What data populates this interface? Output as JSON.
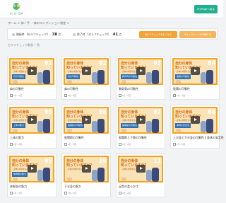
{
  "header": {
    "logo_text": "ぱくぱく広場",
    "mypage_label": "MyPageへ戻る"
  },
  "breadcrumb": "ホーム > 体 / 手 ・体のコンディション測定 >",
  "stats": {
    "before_label": "開始時 【セルフチェック】",
    "before_value": "38",
    "before_unit": "点",
    "after_label": "終了時 【セルフチェック】",
    "after_value": "41",
    "after_unit": "点",
    "btn_primary": "セルフチェックをおこなう",
    "btn_secondary": "チェックシートを印刷する"
  },
  "section_title": "セルフチェック動画 一覧",
  "cards": [
    {
      "num": "01",
      "title": "肩の可動性",
      "date": "1分 / 2回",
      "label": "肩の可動性"
    },
    {
      "num": "02",
      "title": "肩の可動性",
      "date": "1分 / 2回",
      "label": "肩の可動性"
    },
    {
      "num": "03",
      "title": "胸背骨の可動性",
      "date": "1分 / 2回",
      "label": "胸背骨の可動性"
    },
    {
      "num": "04",
      "title": "股関の可動性",
      "date": "1分 / 2回",
      "label": "股関の可動性"
    },
    {
      "num": "05",
      "title": "上体の筋力",
      "date": "1分 / 2回",
      "label": "上体の筋力"
    },
    {
      "num": "06",
      "title": "股関節の可動性",
      "date": "1分 / 2回",
      "label": "股関節の可動性"
    },
    {
      "num": "07",
      "title": "股関節と下肢の可動性",
      "date": "1分 / 2回",
      "label": "股関節の可動性"
    },
    {
      "num": "08",
      "title": "上半身と下半身の可動性と身体の安定性",
      "date": "1分 / 2回",
      "label": "体幹の安定性"
    },
    {
      "num": "09",
      "title": "体幹部の筋力",
      "date": "1分 / 2回",
      "label": "体幹部の筋力"
    },
    {
      "num": "10",
      "title": "下半身の筋力",
      "date": "1分 / 2回",
      "label": ""
    },
    {
      "num": "11",
      "title": "足首の柔らかさ",
      "date": "1分 / 2回",
      "label": ""
    }
  ],
  "thumb_text": {
    "line1": "自分の身体",
    "line2": "知っていますか?",
    "sub": "~身体の状態を知る~"
  },
  "colors": {
    "accent": "#21b08e",
    "orange": "#f5a423",
    "button": "#f2a43a"
  },
  "icons": [
    "calendar-icon",
    "play-icon"
  ]
}
